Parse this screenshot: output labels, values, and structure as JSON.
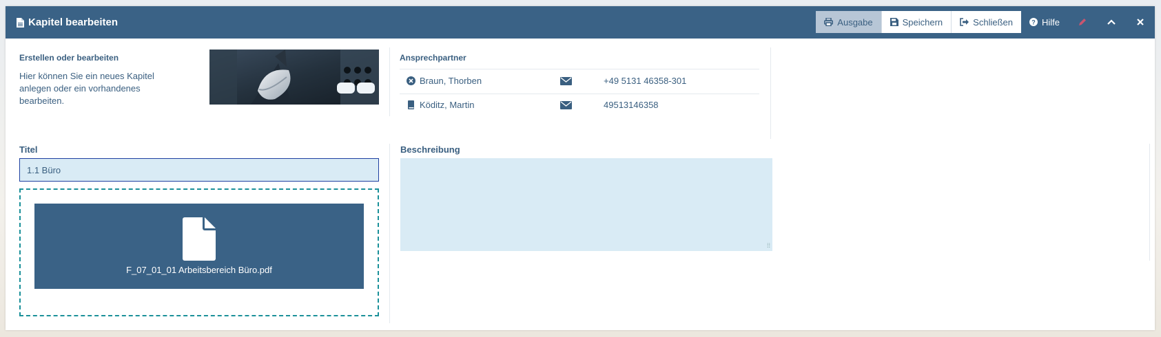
{
  "window": {
    "title": "Kapitel bearbeiten",
    "toolbar": {
      "ausgabe": "Ausgabe",
      "speichern": "Speichern",
      "schliessen": "Schließen",
      "hilfe": "Hilfe"
    }
  },
  "intro": {
    "heading": "Erstellen oder bearbeiten",
    "text_lines": [
      "Hier können Sie ein neues Kapitel",
      "anlegen oder ein vorhandenes",
      "bearbeiten."
    ]
  },
  "contacts": {
    "heading": "Ansprechpartner",
    "rows": [
      {
        "name": "Braun, Thorben",
        "phone": "+49 5131 46358-301",
        "icon": "circle-x-icon"
      },
      {
        "name": "Köditz, Martin",
        "phone": "49513146358",
        "icon": "book-icon"
      }
    ]
  },
  "form": {
    "title_label": "Titel",
    "title_value": "1.1 Büro",
    "file_name": "F_07_01_01 Arbeitsbereich Büro.pdf",
    "description_label": "Beschreibung",
    "description_value": ""
  },
  "colors": {
    "titlebar": "#3a6286",
    "accent_text": "#3a5f80",
    "field_bg": "#d9ebf5",
    "dropzone_border": "#1a9099"
  }
}
